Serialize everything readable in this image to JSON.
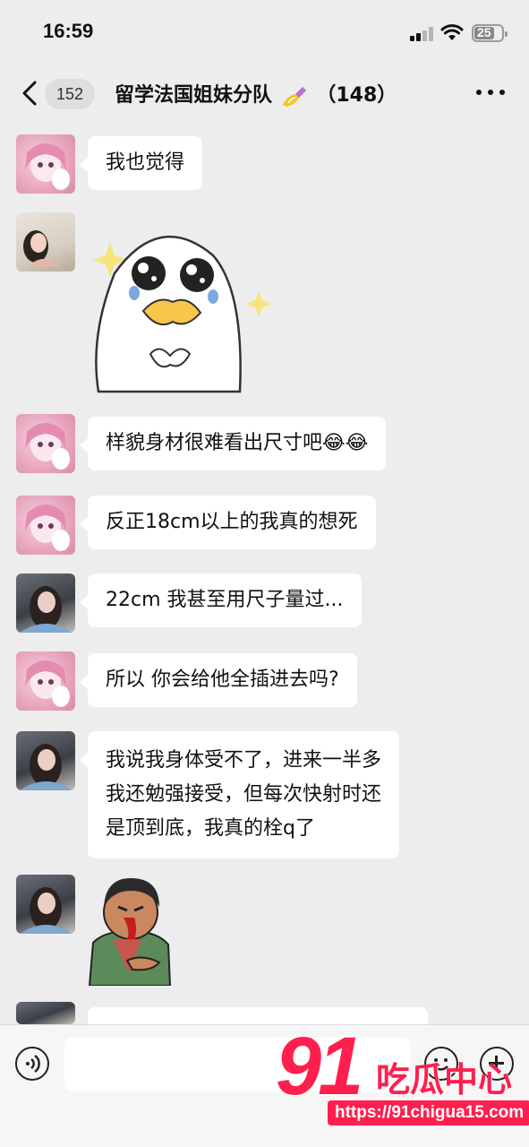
{
  "status_bar": {
    "time": "16:59",
    "battery": "25"
  },
  "nav": {
    "unread_count": "152",
    "title": "留学法国姐妹分队",
    "member_count": "（148）"
  },
  "messages": [
    {
      "sender": "pink-anime-avatar",
      "type": "text",
      "text": "我也觉得"
    },
    {
      "sender": "girl-photo-avatar",
      "type": "sticker",
      "sticker": "crying-duck-sticker"
    },
    {
      "sender": "pink-anime-avatar",
      "type": "text",
      "text": "样貌身材很难看出尺寸吧😂😂"
    },
    {
      "sender": "pink-anime-avatar",
      "type": "text",
      "text": "反正18cm以上的我真的想死"
    },
    {
      "sender": "dark-hair-avatar",
      "type": "text",
      "text": "22cm 我甚至用尺子量过..."
    },
    {
      "sender": "pink-anime-avatar",
      "type": "text",
      "text": "所以 你会给他全插进去吗?"
    },
    {
      "sender": "dark-hair-avatar",
      "type": "text",
      "lines": [
        "我说我身体受不了，进来一半多",
        "我还勉强接受，但每次快射时还",
        "是顶到底，我真的栓q了"
      ]
    },
    {
      "sender": "dark-hair-avatar",
      "type": "sticker",
      "sticker": "nosebleed-boy-sticker"
    },
    {
      "sender": "dark-hair-avatar",
      "type": "text",
      "text": ""
    }
  ],
  "watermark": {
    "logo": "91",
    "brand": "吃瓜中心",
    "url": "https://91chigua15.com"
  },
  "colors": {
    "background": "#ededed",
    "bubble": "#ffffff",
    "watermark": "#ff1f4e"
  }
}
